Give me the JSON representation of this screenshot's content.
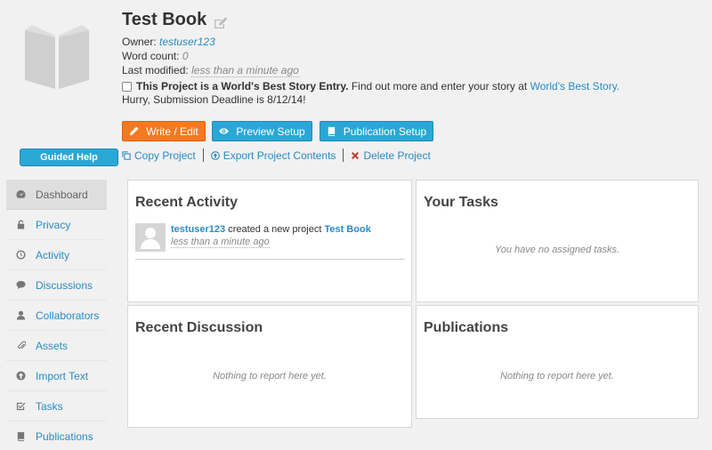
{
  "project": {
    "title": "Test Book",
    "owner_label": "Owner:",
    "owner": "testuser123",
    "word_count_label": "Word count:",
    "word_count": "0",
    "last_modified_label": "Last modified:",
    "last_modified": "less than a minute ago"
  },
  "contest": {
    "bold_text": "This Project is a World's Best Story Entry.",
    "text": " Find out more and enter your story at ",
    "link": "World's Best Story.",
    "deadline": "Hurry, Submission Deadline is 8/12/14!"
  },
  "buttons": {
    "write": "Write / Edit",
    "preview": "Preview Setup",
    "publication": "Publication Setup"
  },
  "actions": {
    "copy": "Copy Project",
    "export": "Export Project Contents",
    "delete": "Delete Project"
  },
  "sidebar": {
    "guided_help": "Guided Help",
    "items": [
      {
        "label": "Dashboard",
        "icon": "dashboard-icon"
      },
      {
        "label": "Privacy",
        "icon": "lock-icon"
      },
      {
        "label": "Activity",
        "icon": "clock-icon"
      },
      {
        "label": "Discussions",
        "icon": "comment-icon"
      },
      {
        "label": "Collaborators",
        "icon": "user-icon"
      },
      {
        "label": "Assets",
        "icon": "paperclip-icon"
      },
      {
        "label": "Import Text",
        "icon": "upload-icon"
      },
      {
        "label": "Tasks",
        "icon": "checkbox-icon"
      },
      {
        "label": "Publications",
        "icon": "book-icon"
      }
    ]
  },
  "panels": {
    "activity": {
      "title": "Recent Activity",
      "item": {
        "user": "testuser123",
        "action": " created a new project ",
        "project": "Test Book",
        "time": "less than a minute ago"
      }
    },
    "tasks": {
      "title": "Your Tasks",
      "empty": "You have no assigned tasks."
    },
    "discussion": {
      "title": "Recent Discussion",
      "empty": "Nothing to report here yet."
    },
    "publications": {
      "title": "Publications",
      "empty": "Nothing to report here yet."
    }
  },
  "colors": {
    "accent_blue": "#2ba7d6",
    "accent_orange": "#f5791f",
    "link": "#2a8bc4",
    "delete_x": "#c0392b"
  }
}
